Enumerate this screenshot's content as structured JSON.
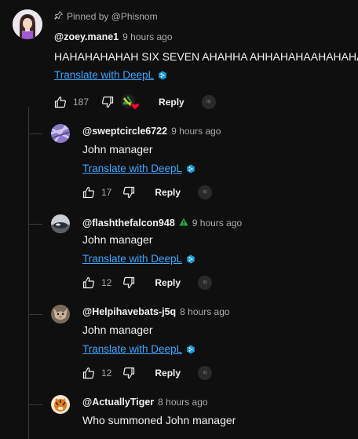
{
  "pinned": {
    "label": "Pinned by @Phisnom"
  },
  "main_comment": {
    "handle": "@zoey.mane1",
    "time": "9 hours ago",
    "text": "HAHAHAHAHAH SIX SEVEN AHAHHA AHHAHAHAAHAHAHA",
    "translate": "Translate with DeepL",
    "likes": "187",
    "reply": "Reply",
    "badge": "IQ"
  },
  "replies": [
    {
      "handle": "@sweptcircle6722",
      "time": "9 hours ago",
      "text": "John manager",
      "translate": "Translate with DeepL",
      "likes": "17",
      "reply": "Reply",
      "badge": "IQ"
    },
    {
      "handle": "@flashthefalcon948",
      "time": "9 hours ago",
      "text": "John manager",
      "translate": "Translate with DeepL",
      "likes": "12",
      "reply": "Reply",
      "badge": "IQ"
    },
    {
      "handle": "@Helpihavebats-j5q",
      "time": "8 hours ago",
      "text": "John manager",
      "translate": "Translate with DeepL",
      "likes": "12",
      "reply": "Reply",
      "badge": "IQ"
    },
    {
      "handle": "@ActuallyTiger",
      "time": "8 hours ago",
      "text": "Who summoned John manager"
    }
  ],
  "icons": {
    "pin": "pin-icon",
    "like": "thumbs-up-icon",
    "dislike": "thumbs-down-icon",
    "deepl": "deepl-icon",
    "warning": "warning-triangle-icon",
    "creator_heart": "creator-heart-icon"
  },
  "colors": {
    "background": "#0f0f0f",
    "link": "#3ea6ff",
    "secondary_text": "#aaaaaa",
    "warning": "#2ba640",
    "heart": "#ff0033"
  }
}
